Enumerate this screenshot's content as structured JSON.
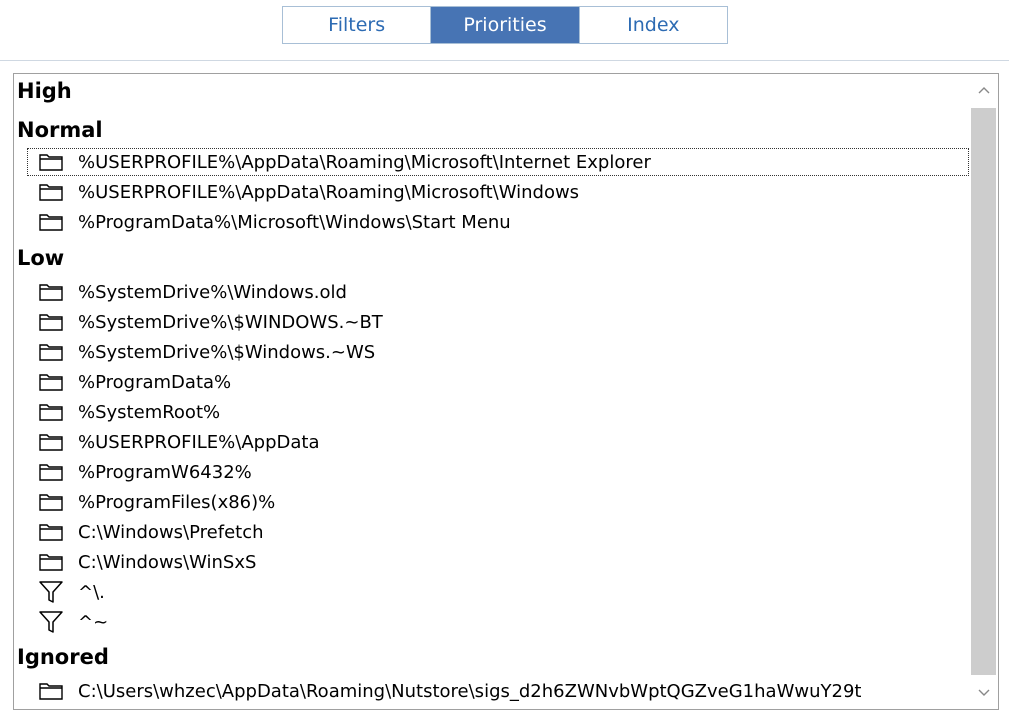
{
  "tabs": [
    {
      "label": "Filters",
      "active": false
    },
    {
      "label": "Priorities",
      "active": true
    },
    {
      "label": "Index",
      "active": false
    }
  ],
  "groups": {
    "high": "High",
    "normal": "Normal",
    "low": "Low",
    "ignored": "Ignored"
  },
  "normal_items": [
    {
      "icon": "folder-icon",
      "label": "%USERPROFILE%\\AppData\\Roaming\\Microsoft\\Internet Explorer"
    },
    {
      "icon": "folder-icon",
      "label": "%USERPROFILE%\\AppData\\Roaming\\Microsoft\\Windows"
    },
    {
      "icon": "folder-icon",
      "label": "%ProgramData%\\Microsoft\\Windows\\Start Menu"
    }
  ],
  "low_items": [
    {
      "icon": "folder-icon",
      "label": "%SystemDrive%\\Windows.old"
    },
    {
      "icon": "folder-icon",
      "label": "%SystemDrive%\\$WINDOWS.~BT"
    },
    {
      "icon": "folder-icon",
      "label": "%SystemDrive%\\$Windows.~WS"
    },
    {
      "icon": "folder-icon",
      "label": "%ProgramData%"
    },
    {
      "icon": "folder-icon",
      "label": "%SystemRoot%"
    },
    {
      "icon": "folder-icon",
      "label": "%USERPROFILE%\\AppData"
    },
    {
      "icon": "folder-icon",
      "label": "%ProgramW6432%"
    },
    {
      "icon": "folder-icon",
      "label": "%ProgramFiles(x86)%"
    },
    {
      "icon": "folder-icon",
      "label": "C:\\Windows\\Prefetch"
    },
    {
      "icon": "folder-icon",
      "label": "C:\\Windows\\WinSxS"
    },
    {
      "icon": "filter-icon",
      "label": "^\\."
    },
    {
      "icon": "filter-icon",
      "label": "^~"
    }
  ],
  "ignored_items": [
    {
      "icon": "folder-icon",
      "label": "C:\\Users\\whzec\\AppData\\Roaming\\Nutstore\\sigs_d2h6ZWNvbWptQGZveG1haWwuY29t"
    }
  ],
  "colors": {
    "accent": "#4774b4",
    "tab_text": "#2d6bb3",
    "scroll_thumb": "#cdcdcd"
  }
}
